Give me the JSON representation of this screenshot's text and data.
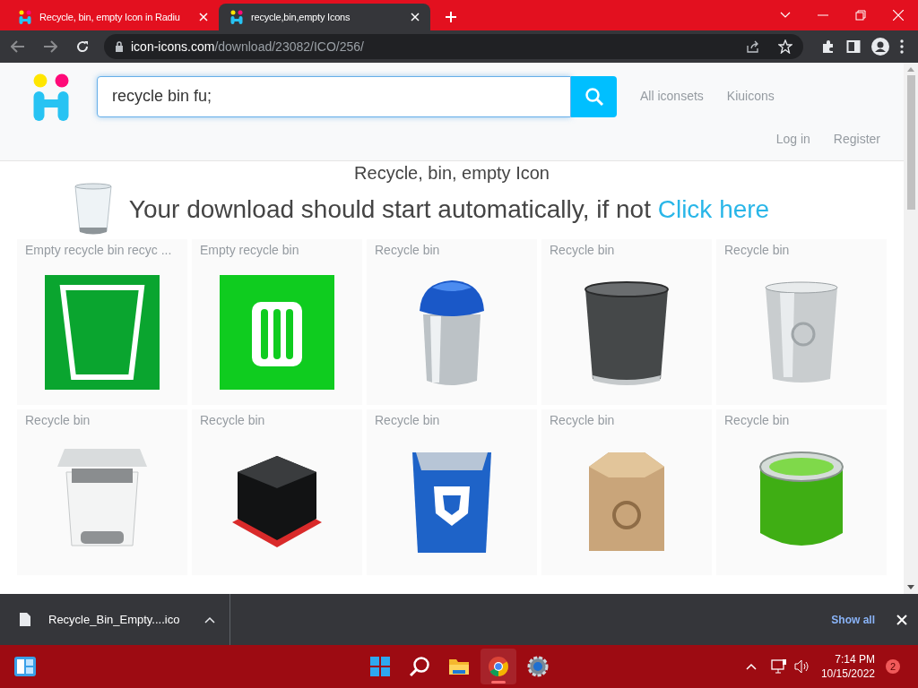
{
  "browser": {
    "tabs": [
      {
        "title": "Recycle, bin, empty Icon in Radiu",
        "selected": false
      },
      {
        "title": "recycle,bin,empty Icons",
        "selected": true
      }
    ],
    "address": {
      "host": "icon-icons.com",
      "path": "/download/23082/ICO/256/"
    }
  },
  "page": {
    "search": {
      "value": "recycle bin fu;"
    },
    "nav": [
      "All iconsets",
      "Kiuicons"
    ],
    "account": [
      "Log in",
      "Register"
    ],
    "heading": "Recycle, bin, empty Icon",
    "download_message": "Your download should start automatically, if not",
    "download_link": "Click here",
    "results": [
      "Empty recycle bin recyc ...",
      "Empty recycle bin",
      "Recycle bin",
      "Recycle bin",
      "Recycle bin",
      "Recycle bin",
      "Recycle bin",
      "Recycle bin",
      "Recycle bin",
      "Recycle bin"
    ]
  },
  "download_bar": {
    "file": "Recycle_Bin_Empty....ico",
    "show_all": "Show all"
  },
  "taskbar": {
    "apps": [
      {
        "selected": false
      },
      {
        "selected": false
      },
      {
        "selected": false
      },
      {
        "selected": true
      },
      {
        "selected": false
      }
    ],
    "time": "7:14 PM",
    "date": "10/15/2022",
    "badge": "2"
  }
}
